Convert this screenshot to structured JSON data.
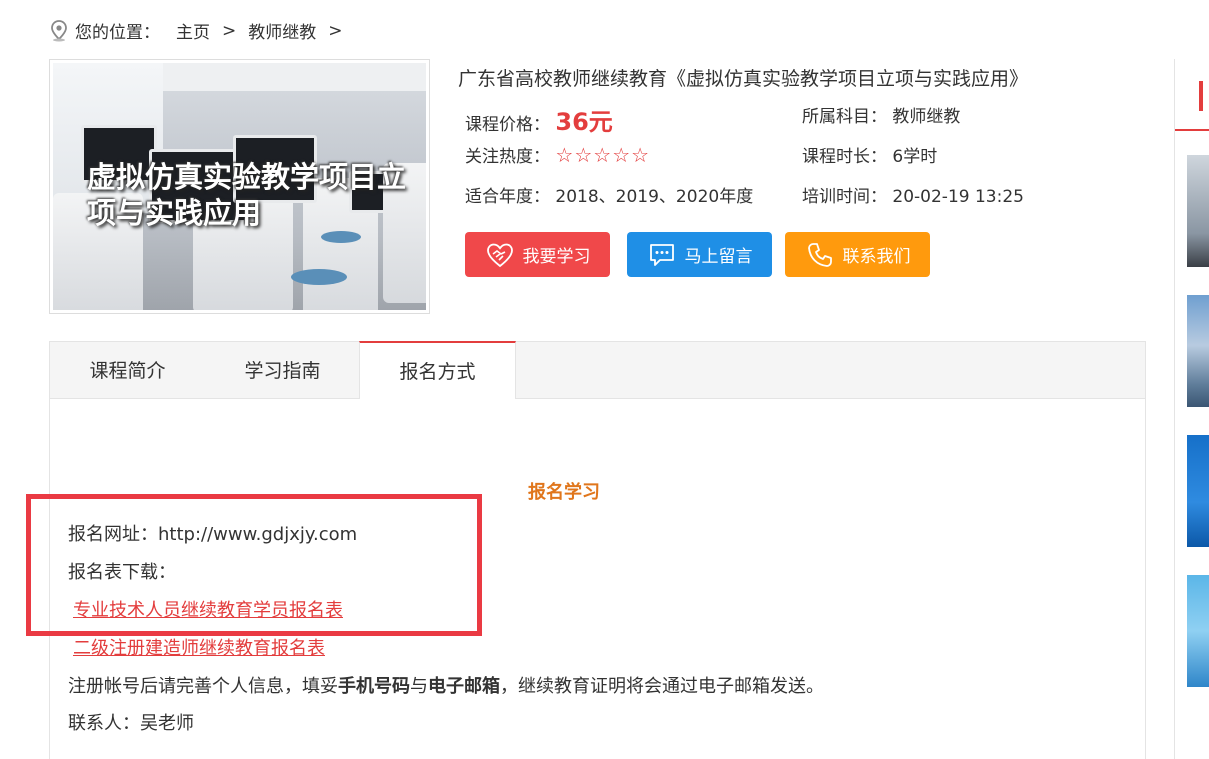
{
  "breadcrumb": {
    "label": "您的位置：",
    "home": "主页",
    "separator": ">",
    "category": "教师继教",
    "trailing_separator": ">"
  },
  "thumbnail": {
    "caption_line1": "虚拟仿真实验教学项目立",
    "caption_line2": "项与实践应用"
  },
  "course": {
    "title": "广东省高校教师继续教育《虚拟仿真实验教学项目立项与实践应用》",
    "price_label": "课程价格：",
    "price_value": "36元",
    "subject_label": "所属科目：",
    "subject_value": "教师继教",
    "heat_label": "关注热度：",
    "heat_stars": "☆☆☆☆☆",
    "hours_label": "课程时长：",
    "hours_value": "6学时",
    "year_label": "适合年度：",
    "year_value": "2018、2019、2020年度",
    "time_label": "培训时间：",
    "time_value": "20-02-19 13:25"
  },
  "actions": {
    "learn": "我要学习",
    "message": "马上留言",
    "contact": "联系我们"
  },
  "tabs": [
    {
      "label": "课程简介"
    },
    {
      "label": "学习指南"
    },
    {
      "label": "报名方式"
    }
  ],
  "signup": {
    "section_title": "报名学习",
    "url_label": "报名网址：",
    "url_value": "http://www.gdjxjy.com",
    "form_label": "报名表下载：",
    "form_link_1": "专业技术人员继续教育学员报名表",
    "form_link_2": "二级注册建造师继续教育报名表",
    "note_prefix": "注册帐号后请完善个人信息，填妥",
    "note_bold_1": "手机号码",
    "note_mid": "与",
    "note_bold_2": "电子邮箱",
    "note_suffix": "，继续教育证明将会通过电子邮箱发送。",
    "contact_label": "联系人：",
    "contact_value": "吴老师"
  },
  "colors": {
    "accent_red": "#e33d3d",
    "btn_red": "#f0484a",
    "btn_blue": "#1f8fe6",
    "btn_orange": "#ff9a0d",
    "section_orange": "#e0761c",
    "highlight_box": "#ea3a43"
  }
}
